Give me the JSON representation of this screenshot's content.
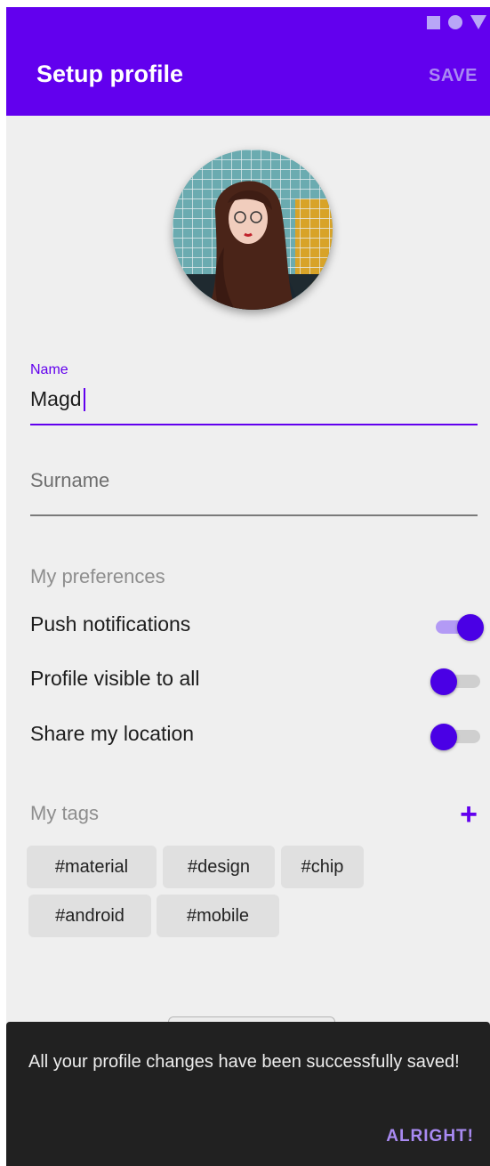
{
  "status_bar": {
    "icons": [
      "square-icon",
      "circle-icon",
      "triangle-icon"
    ]
  },
  "app_bar": {
    "title": "Setup profile",
    "save_label": "SAVE"
  },
  "avatar": {
    "icon": "profile-photo"
  },
  "name_field": {
    "label": "Name",
    "value": "Magd"
  },
  "surname_field": {
    "placeholder": "Surname",
    "value": ""
  },
  "preferences": {
    "title": "My preferences",
    "items": [
      {
        "label": "Push notifications",
        "enabled": true
      },
      {
        "label": "Profile visible to all",
        "enabled": false
      },
      {
        "label": "Share my location",
        "enabled": false
      }
    ]
  },
  "tags": {
    "title": "My tags",
    "add_icon": "+",
    "chips": [
      "#material",
      "#design",
      "#chip",
      "#android",
      "#mobile"
    ]
  },
  "snackbar": {
    "message": "All your profile changes have been successfully saved!",
    "action": "ALRIGHT!"
  },
  "colors": {
    "primary": "#6200ee",
    "switch_thumb": "#4a00e5",
    "snackbar_bg": "#212121",
    "snackbar_action": "#a98af2"
  }
}
